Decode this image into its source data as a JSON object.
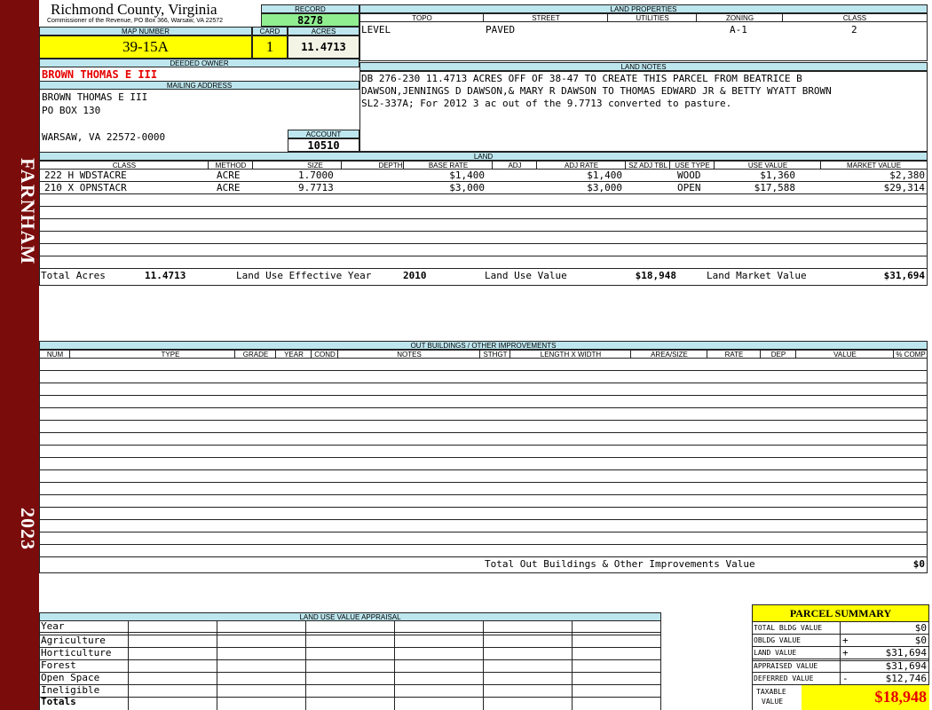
{
  "side": {
    "district": "FARNHAM",
    "year": "2023"
  },
  "header": {
    "county": "Richmond County, Virginia",
    "commissioner": "Commissioner of the Revenue, PO Box 366, Warsaw, VA 22572",
    "record_label": "RECORD",
    "record": "8278",
    "map_number_label": "MAP NUMBER",
    "map_number": "39-15A",
    "card_label": "CARD",
    "card": "1",
    "acres_label": "ACRES",
    "acres": "11.4713"
  },
  "owner": {
    "deeded_label": "DEEDED OWNER",
    "deeded_owner": "BROWN THOMAS E III",
    "mailing_label": "MAILING ADDRESS",
    "line1": "BROWN THOMAS E III",
    "line2": "PO BOX 130",
    "line3": "",
    "line4": "WARSAW, VA 22572-0000",
    "account_label": "ACCOUNT",
    "account": "10510"
  },
  "land_properties": {
    "title": "LAND PROPERTIES",
    "headers": [
      "TOPO",
      "STREET",
      "UTILITIES",
      "ZONING",
      "CLASS"
    ],
    "topo": "LEVEL",
    "street": "PAVED",
    "utilities": "",
    "zoning": "A-1",
    "class": "2"
  },
  "land_notes": {
    "title": "LAND NOTES",
    "line1": "DB 276-230 11.4713 ACRES OFF OF 38-47 TO CREATE THIS PARCEL FROM BEATRICE B",
    "line2": "DAWSON,JENNINGS D DAWSON,& MARY R DAWSON TO THOMAS EDWARD JR & BETTY WYATT BROWN",
    "line3": "SL2-337A; For 2012 3 ac out of the 9.7713 converted to pasture."
  },
  "land": {
    "title": "LAND",
    "headers": [
      "CLASS",
      "METHOD",
      "SIZE",
      "DEPTH",
      "BASE RATE",
      "ADJ",
      "ADJ RATE",
      "SZ ADJ TBL",
      "USE TYPE",
      "USE VALUE",
      "MARKET VALUE"
    ],
    "rows": [
      {
        "class": "222 H WDSTACRE",
        "method": "ACRE",
        "size": "1.7000",
        "depth": "",
        "base_rate": "$1,400",
        "adj": "",
        "adj_rate": "$1,400",
        "sz": "",
        "use_type": "WOOD",
        "use_value": "$1,360",
        "market_value": "$2,380"
      },
      {
        "class": "210 X OPNSTACR",
        "method": "ACRE",
        "size": "9.7713",
        "depth": "",
        "base_rate": "$3,000",
        "adj": "",
        "adj_rate": "$3,000",
        "sz": "",
        "use_type": "OPEN",
        "use_value": "$17,588",
        "market_value": "$29,314"
      }
    ],
    "total_acres_label": "Total Acres",
    "total_acres": "11.4713",
    "effective_year_label": "Land Use Effective Year",
    "effective_year": "2010",
    "use_value_label": "Land Use Value",
    "use_value": "$18,948",
    "market_value_label": "Land Market Value",
    "market_value": "$31,694"
  },
  "outbuildings": {
    "title": "OUT BUILDINGS / OTHER IMPROVEMENTS",
    "headers": [
      "NUM",
      "TYPE",
      "GRADE",
      "YEAR",
      "COND",
      "NOTES",
      "STHGT",
      "LENGTH X WIDTH",
      "AREA/SIZE",
      "RATE",
      "DEP",
      "VALUE",
      "% COMP"
    ],
    "total_label": "Total Out Buildings & Other Improvements Value",
    "total": "$0"
  },
  "luv": {
    "title": "LAND USE VALUE APPRAISAL",
    "rows": [
      "Year",
      "Agriculture",
      "Horticulture",
      "Forest",
      "Open Space",
      "Ineligible",
      "Totals"
    ]
  },
  "summary": {
    "title": "PARCEL SUMMARY",
    "rows": [
      {
        "label": "TOTAL BLDG VALUE",
        "op": "",
        "value": "$0"
      },
      {
        "label": "OBLDG VALUE",
        "op": "+",
        "value": "$0"
      },
      {
        "label": "LAND VALUE",
        "op": "+",
        "value": "$31,694"
      },
      {
        "label": "APPRAISED VALUE",
        "op": "",
        "value": "$31,694"
      },
      {
        "label": "DEFERRED VALUE",
        "op": "-",
        "value": "$12,746"
      }
    ],
    "taxable_label_1": "TAXABLE",
    "taxable_label_2": "VALUE",
    "taxable": "$18,948",
    "accent": "#ffff00",
    "red": "#e60000"
  }
}
